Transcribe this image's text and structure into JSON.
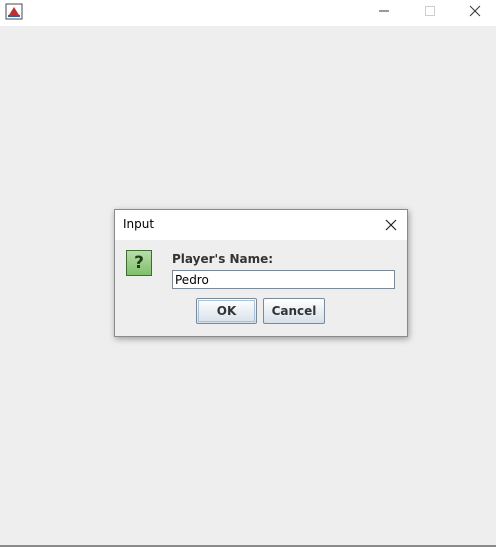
{
  "app_window": {
    "icons": {
      "app": "java-app-icon",
      "minimize": "minimize-icon",
      "maximize": "maximize-icon",
      "close": "close-icon"
    }
  },
  "dialog": {
    "title": "Input",
    "icon": "question-icon",
    "icon_glyph": "?",
    "prompt": "Player's Name:",
    "input_value": "Pedro",
    "ok_label": "OK",
    "cancel_label": "Cancel",
    "close_icon": "close-icon"
  },
  "colors": {
    "background": "#eeeeee",
    "question_icon": "#7fbf6a"
  }
}
